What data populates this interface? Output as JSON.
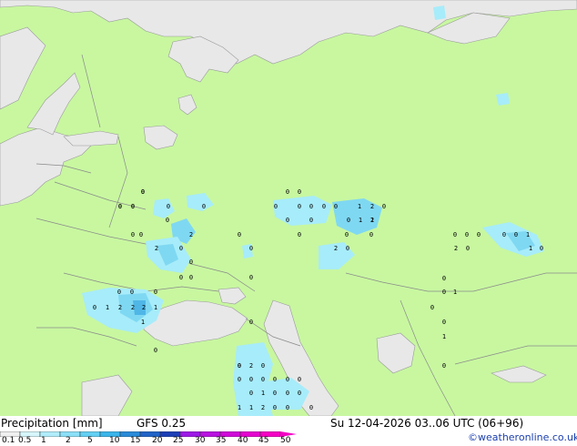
{
  "map": {
    "land_color": "#c8f7a0",
    "water_color": "#e8e8e8",
    "border_color": "#7f7f7f",
    "precip_colors": [
      "#a7ecfa",
      "#7fd8f2",
      "#4fb6e6",
      "#3a8fd6"
    ],
    "values": [
      "0",
      "0",
      "0",
      "0",
      "0",
      "0",
      "2",
      "0",
      "0",
      "0",
      "2",
      "0",
      "0",
      "0",
      "0",
      "0",
      "0",
      "0",
      "1",
      "2",
      "2",
      "2",
      "1",
      "0",
      "1",
      "0",
      "0",
      "0",
      "0",
      "0",
      "0",
      "0",
      "0",
      "0",
      "0",
      "0",
      "0",
      "0",
      "1",
      "2",
      "2",
      "0",
      "0",
      "1",
      "1",
      "2",
      "0",
      "0",
      "0",
      "0",
      "0",
      "0",
      "0",
      "1",
      "2",
      "0",
      "1",
      "0",
      "0",
      "1",
      "0",
      "0",
      "0",
      "1",
      "0",
      "0",
      "0",
      "0",
      "0",
      "0",
      "2",
      "0",
      "0",
      "0",
      "0",
      "0",
      "0",
      "1",
      "0",
      "0",
      "0",
      "1",
      "1",
      "2",
      "0",
      "0",
      "0",
      "0",
      "0",
      "0",
      "0"
    ]
  },
  "footer": {
    "title": "Precipitation [mm]",
    "model": "GFS 0.25",
    "datetime": "Su 12-04-2026 03..06 UTC (06+96)",
    "credit": "©weatheronline.co.uk"
  },
  "legend": {
    "ticks": [
      "0.1",
      "0.5",
      "1",
      "2",
      "5",
      "10",
      "15",
      "20",
      "25",
      "30",
      "35",
      "40",
      "45",
      "50"
    ],
    "colors": [
      "#f0f0f0",
      "#d6f6fc",
      "#b1ecfa",
      "#8be0f7",
      "#62cff3",
      "#3bb5ea",
      "#2a8bd8",
      "#2164c7",
      "#1c3fb6",
      "#9d1ae6",
      "#b812e0",
      "#cf0ad8",
      "#e403cf",
      "#f500c4"
    ]
  }
}
